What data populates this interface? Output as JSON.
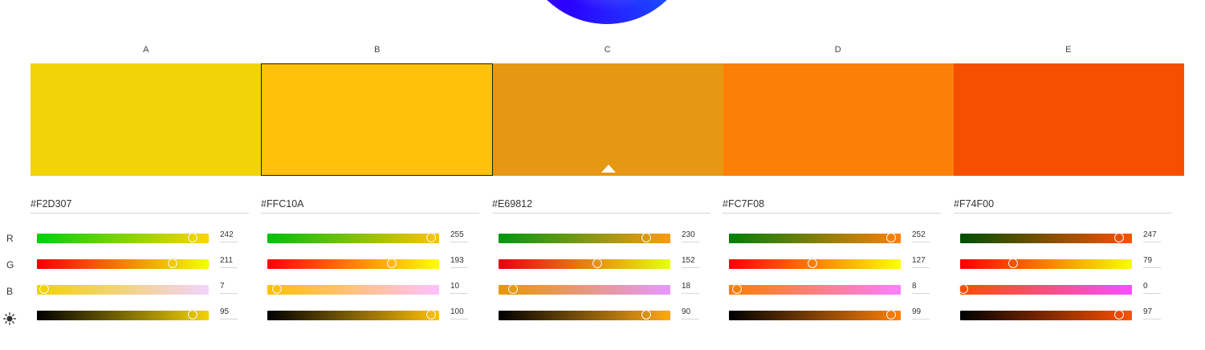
{
  "columns": [
    {
      "letter": "A",
      "hex": "#F2D307",
      "color": "#F2D307",
      "selected": false,
      "r": 242,
      "g": 211,
      "b": 7,
      "brightness": 95,
      "grad_r": "linear-gradient(90deg,#00D307,#FFD307)",
      "grad_g": "linear-gradient(90deg,#F20007,#F2FF07)",
      "grad_b": "linear-gradient(90deg,#F2D300,#F2D3FF)",
      "grad_v": "linear-gradient(90deg,#000000,#F2D307)"
    },
    {
      "letter": "B",
      "hex": "#FFC10A",
      "color": "#FFC10A",
      "selected": true,
      "r": 255,
      "g": 193,
      "b": 10,
      "brightness": 100,
      "grad_r": "linear-gradient(90deg,#00C10A,#FFC10A)",
      "grad_g": "linear-gradient(90deg,#FF000A,#FFFF0A)",
      "grad_b": "linear-gradient(90deg,#FFC100,#FFC1FF)",
      "grad_v": "linear-gradient(90deg,#000000,#FFC10A)"
    },
    {
      "letter": "C",
      "hex": "#E69812",
      "color": "#E69812",
      "selected": false,
      "r": 230,
      "g": 152,
      "b": 18,
      "brightness": 90,
      "grad_r": "linear-gradient(90deg,#009812,#FF9812)",
      "grad_g": "linear-gradient(90deg,#E60012,#E6FF12)",
      "grad_b": "linear-gradient(90deg,#E69800,#E698FF)",
      "grad_v": "linear-gradient(90deg,#000000,#FFA914)"
    },
    {
      "letter": "D",
      "hex": "#FC7F08",
      "color": "#FC7F08",
      "selected": false,
      "r": 252,
      "g": 127,
      "b": 8,
      "brightness": 99,
      "grad_r": "linear-gradient(90deg,#007F08,#FF7F08)",
      "grad_g": "linear-gradient(90deg,#FC0008,#FCFF08)",
      "grad_b": "linear-gradient(90deg,#FC7F00,#FC7FFF)",
      "grad_v": "linear-gradient(90deg,#000000,#FF8008)"
    },
    {
      "letter": "E",
      "hex": "#F74F00",
      "color": "#F74F00",
      "selected": false,
      "r": 247,
      "g": 79,
      "b": 0,
      "brightness": 97,
      "grad_r": "linear-gradient(90deg,#004F00,#FF4F00)",
      "grad_g": "linear-gradient(90deg,#F70000,#F7FF00)",
      "grad_b": "linear-gradient(90deg,#F74F00,#F74FFF)",
      "grad_v": "linear-gradient(90deg,#000000,#FF5100)"
    }
  ],
  "row_labels": {
    "r": "R",
    "g": "G",
    "b": "B"
  },
  "icons": {
    "brightness": "sun-icon"
  }
}
